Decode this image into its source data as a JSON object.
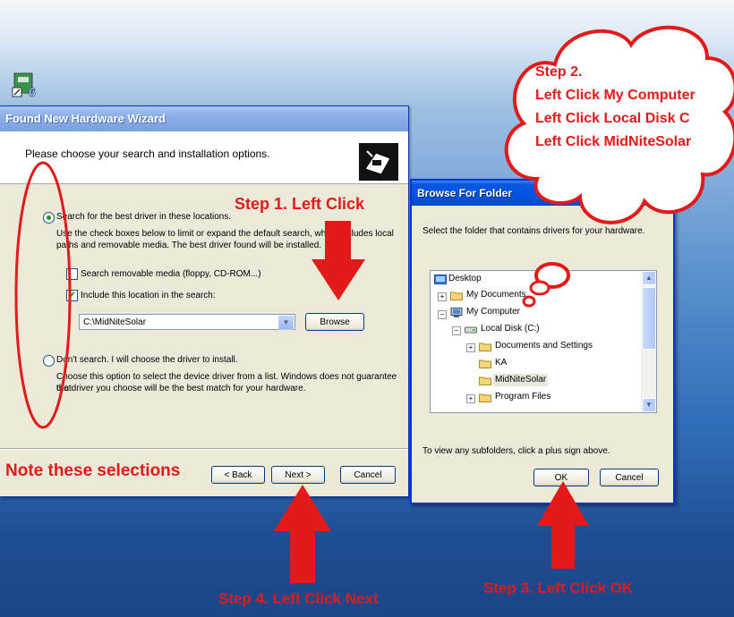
{
  "wizard": {
    "title": "Found New Hardware Wizard",
    "heading": "Please choose your search and installation options.",
    "option_search_label": "Search for the best driver in these locations.",
    "option_search_desc_1": "Use the check boxes below to limit or expand the default search, which includes local",
    "option_search_desc_2": "paths and removable media. The best driver found will be installed.",
    "checkbox_removable_label": "Search removable media (floppy, CD-ROM...)",
    "checkbox_include_label": "Include this location in the search:",
    "location_value": "C:\\MidNiteSolar",
    "browse_label": "Browse",
    "option_dont_search_label": "Don't search. I will choose the driver to install.",
    "option_dont_desc_1": "Choose this option to select the device driver from a list.  Windows does not guarantee that",
    "option_dont_desc_2": "the driver you choose will be the best match for your hardware.",
    "back_label": "< Back",
    "next_label": "Next >",
    "cancel_label": "Cancel"
  },
  "browse_dialog": {
    "title": "Browse For Folder",
    "help_label": "?",
    "close_label": "✕",
    "instruction": "Select the folder that contains drivers for your hardware.",
    "tree": [
      {
        "label": "Desktop"
      },
      {
        "label": "My Documents"
      },
      {
        "label": "My Computer"
      },
      {
        "label": "Local Disk (C:)"
      },
      {
        "label": "Documents and Settings"
      },
      {
        "label": "KA"
      },
      {
        "label": "MidNiteSolar"
      },
      {
        "label": "Program Files"
      }
    ],
    "hint": "To view any subfolders, click a plus sign above.",
    "ok_label": "OK",
    "cancel_label": "Cancel"
  },
  "annotations": {
    "step1": "Step 1. Left Click",
    "step2_lines": [
      "Step 2.",
      "Left Click My Computer",
      "Left Click Local Disk C",
      "Left Click MidNiteSolar"
    ],
    "step3": "Step 3. Left Click OK",
    "step4": "Step 4. Left Click Next",
    "note": "Note these selections",
    "color": "#e21a1a"
  }
}
